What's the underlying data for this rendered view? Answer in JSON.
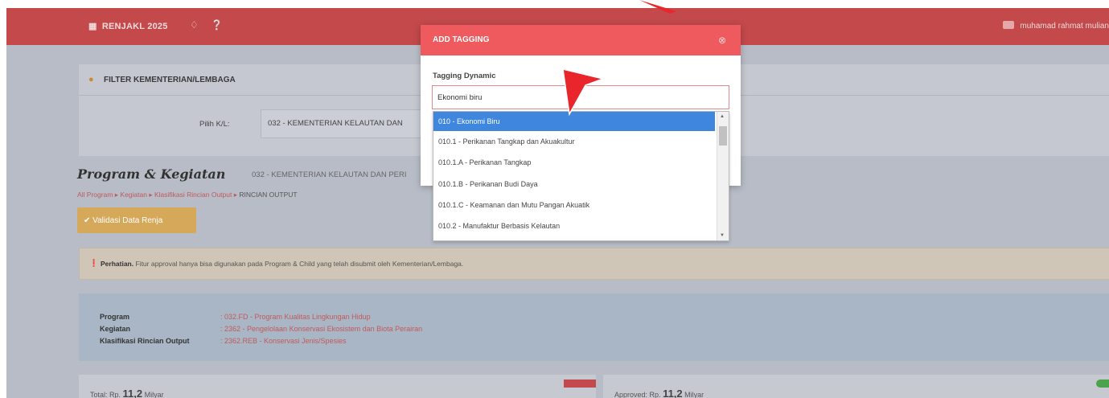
{
  "header": {
    "brand": "RENJAKL 2025",
    "user": "muhamad rahmat mulian"
  },
  "filter": {
    "title": "FILTER KEMENTERIAN/LEMBAGA",
    "pilih_label": "Pilih K/L:",
    "pilih_value": "032 - KEMENTERIAN KELAUTAN DAN"
  },
  "program": {
    "title": "Program & Kegiatan",
    "subtitle": "032 - KEMENTERIAN KELAUTAN DAN PERI",
    "breadcrumb": [
      "All Program",
      "Kegiatan",
      "Klasifikasi Rincian Output",
      "RINCIAN OUTPUT"
    ],
    "validasi_label": "Validasi Data Renja",
    "alert_bold": "Perhatian.",
    "alert_text": "Fitur approval hanya bisa digunakan pada Program & Child yang telah disubmit oleh Kementerian/Lembaga.",
    "info": [
      {
        "label": "Program",
        "value": ": 032.FD - Program Kualitas Lingkungan Hidup"
      },
      {
        "label": "Kegiatan",
        "value": ": 2362 - Pengelolaan Konservasi Ekosistem dan Biota Perairan"
      },
      {
        "label": "Klasifikasi Rincian Output",
        "value": ": 2362.REB - Konservasi Jenis/Spesies"
      }
    ],
    "total_label": "Total: Rp.",
    "total_value": "11,2",
    "total_unit": "Milyar",
    "approved_label": "Approved: Rp.",
    "approved_value": "11,2",
    "approved_unit": "Milyar"
  },
  "modal": {
    "title": "ADD TAGGING",
    "field_label": "Tagging Dynamic",
    "input_value": "Ekonomi biru",
    "options": [
      "010 - Ekonomi Biru",
      "010.1 - Perikanan Tangkap dan Akuakultur",
      "010.1.A - Perikanan Tangkap",
      "010.1.B - Perikanan Budi Daya",
      "010.1.C - Keamanan dan Mutu Pangan Akuatik",
      "010.2 - Manufaktur Berbasis Kelautan"
    ],
    "selected_option": "010 - Ekonomi Biru"
  },
  "colors": {
    "header": "#c3494b",
    "modal_header": "#ee5a5d",
    "selected": "#3f86de",
    "cursor": "#e8262b"
  },
  "icons": [
    "grid-icon",
    "bell-icon",
    "help-icon",
    "user-avatar-icon",
    "close-circle-icon",
    "filter-icon",
    "check-circle-icon",
    "info-icon",
    "cursor-arrow-icon"
  ]
}
